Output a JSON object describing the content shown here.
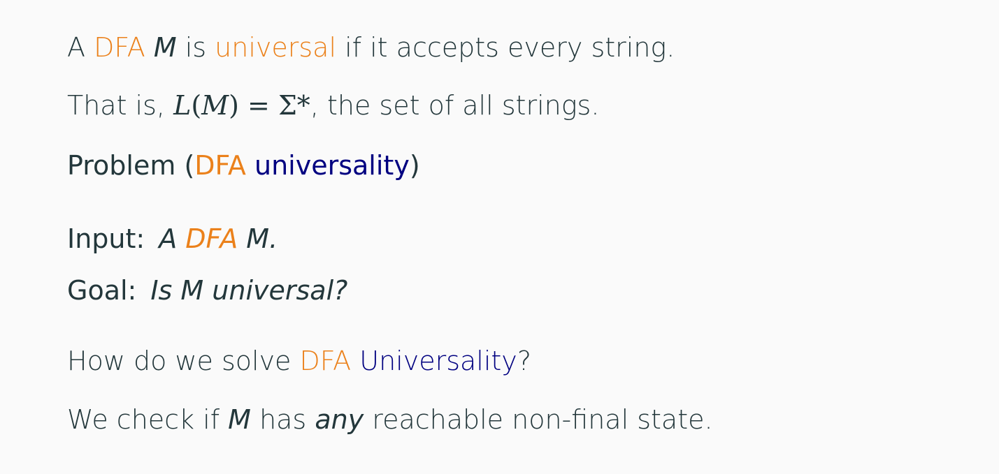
{
  "line1": {
    "a": "A",
    "dfa": "DFA",
    "m": "M",
    "is": "is",
    "universal": "universal",
    "rest": "if it accepts every string."
  },
  "line2": {
    "prefix": "That is,",
    "lang": "L",
    "open": "(",
    "m": "M",
    "close": ")",
    "eq": "=",
    "sigma": "Σ*",
    "rest": ", the set of all strings."
  },
  "problem": {
    "label": "Problem",
    "open": "(",
    "dfa": "DFA",
    "name": "universality",
    "close": ")"
  },
  "input": {
    "label": "Input:",
    "a": "A",
    "dfa": "DFA",
    "m": "M."
  },
  "goal": {
    "label": "Goal:",
    "text": "Is M universal?"
  },
  "question": {
    "prefix": "How do we solve",
    "dfa": "DFA",
    "name": "Universality",
    "suffix": "?"
  },
  "answer": {
    "prefix": "We check if",
    "m": "M",
    "has": "has",
    "any": "any",
    "rest": "reachable non-final state."
  },
  "colors": {
    "accent_orange": "#eb811b",
    "accent_navy": "#000080",
    "text": "#23373b",
    "background": "#fafafa"
  }
}
